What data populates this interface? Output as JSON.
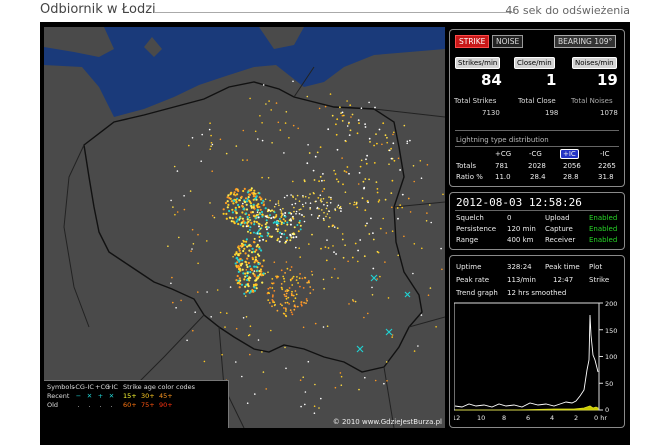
{
  "header": {
    "title": "Odbiornik w Łodzi",
    "refresh": "46 sek do odświeżenia"
  },
  "buttons": {
    "strike": "STRIKE",
    "noise": "NOISE",
    "bearing": "BEARING 109°"
  },
  "rates": {
    "strikes_label": "Strikes/min",
    "close_label": "Close/min",
    "noises_label": "Noises/min",
    "strikes": "84",
    "close": "1",
    "noises": "19"
  },
  "totals": {
    "strikes_label": "Total Strikes",
    "close_label": "Total Close",
    "noises_label": "Total Noises",
    "strikes": "7130",
    "close": "198",
    "noises": "1078"
  },
  "distribution": {
    "title": "Lightning type distribution",
    "headers": [
      "+CG",
      "-CG",
      "+IC",
      "-IC"
    ],
    "rows": [
      {
        "label": "Totals",
        "values": [
          "781",
          "2028",
          "2056",
          "2265"
        ]
      },
      {
        "label": "Ratio %",
        "values": [
          "11.0",
          "28.4",
          "28.8",
          "31.8"
        ]
      }
    ]
  },
  "status": {
    "datetime": "2012-08-03 12:58:26",
    "rows": [
      {
        "label": "Squelch",
        "value": "0",
        "label2": "Upload",
        "value2": "Enabled"
      },
      {
        "label": "Persistence",
        "value": "120 min",
        "label2": "Capture",
        "value2": "Enabled"
      },
      {
        "label": "Range",
        "value": "400 km",
        "label2": "Receiver",
        "value2": "Enabled"
      }
    ]
  },
  "stats": {
    "uptime_label": "Uptime",
    "uptime": "328:24",
    "peak_time_label": "Peak time",
    "plot_label": "Plot",
    "peak_rate_label": "Peak rate",
    "peak_rate": "113/min",
    "peak_time": "12:47",
    "plot_value": "Strike",
    "trend_label": "Trend graph",
    "trend_value": "12 hrs smoothed"
  },
  "trend_graph": {
    "y_ticks": [
      "200",
      "150",
      "100",
      "50",
      "0"
    ],
    "x_ticks": [
      "12",
      "10",
      "8",
      "6",
      "4",
      "2",
      "0 hr"
    ]
  },
  "legend": {
    "header": [
      "Symbols",
      "-CG",
      "-IC",
      "+CG",
      "+IC",
      "Strike age color codes"
    ],
    "recent_label": "Recent",
    "old_label": "Old",
    "recent_symbols": [
      "−",
      "✕",
      "+",
      "✕"
    ],
    "old_symbols": [
      ".",
      ".",
      ".",
      "."
    ],
    "age_recent": [
      "15+",
      "30+",
      "45+"
    ],
    "age_old": [
      "60+",
      "75+",
      "90+"
    ]
  },
  "copyright": "© 2010 www.GdzieJestBurza.pl",
  "colors": {
    "strike_button": "#c81818",
    "enabled": "#27d427",
    "map_land": "#4a4a4a",
    "sea": "#1a3a7a"
  }
}
